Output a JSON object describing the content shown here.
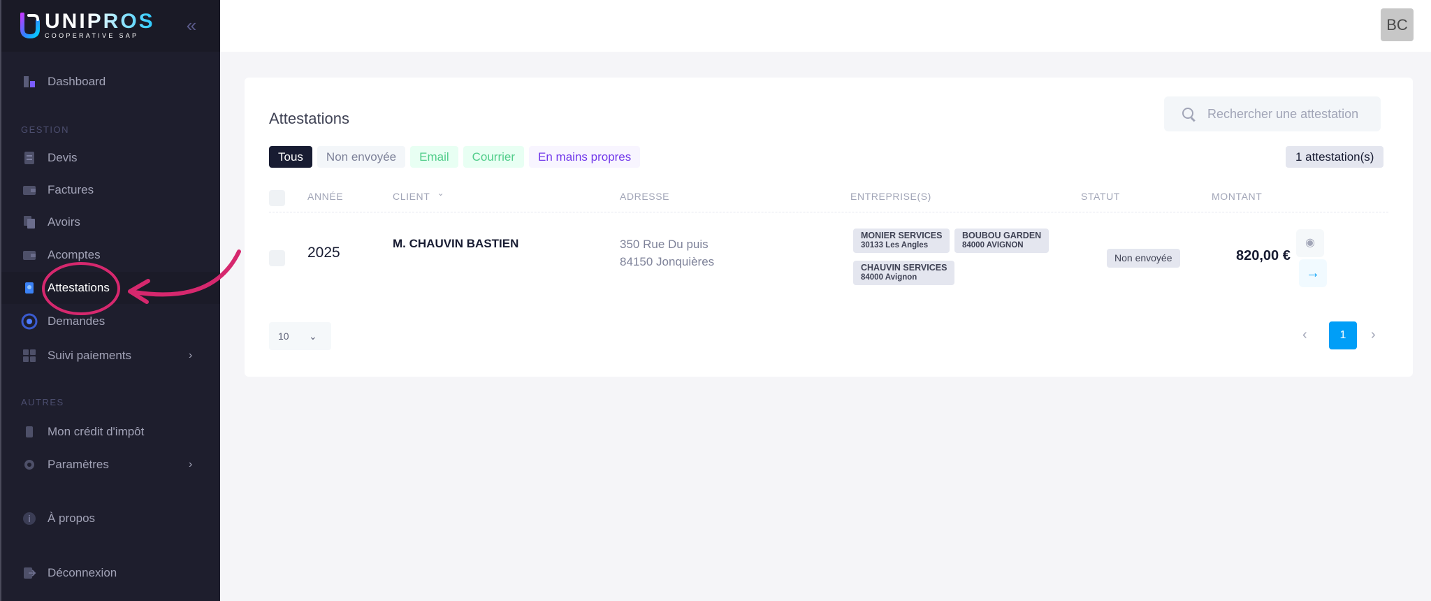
{
  "app": {
    "logo_title": "UNIPROS",
    "logo_subtitle": "COOPERATIVE SAP",
    "collapse_icon": "«",
    "avatar_initials": "BC"
  },
  "sidebar": {
    "dashboard": "Dashboard",
    "section_gestion": "GESTION",
    "devis": "Devis",
    "factures": "Factures",
    "avoirs": "Avoirs",
    "acomptes": "Acomptes",
    "attestations": "Attestations",
    "demandes": "Demandes",
    "suivi_paiements": "Suivi paiements",
    "section_autres": "AUTRES",
    "credit_impot": "Mon crédit d'impôt",
    "parametres": "Paramètres",
    "a_propos": "À propos",
    "deconnexion": "Déconnexion"
  },
  "page": {
    "title": "Attestations",
    "search_placeholder": "Rechercher une attestation",
    "count_badge": "1 attestation(s)",
    "filters": {
      "tous": "Tous",
      "non_envoyee": "Non envoyée",
      "email": "Email",
      "courrier": "Courrier",
      "mains_propres": "En mains propres"
    }
  },
  "table": {
    "headers": {
      "annee": "ANNÉE",
      "client": "CLIENT",
      "adresse": "ADRESSE",
      "entreprises": "ENTREPRISE(S)",
      "statut": "STATUT",
      "montant": "MONTANT"
    },
    "row": {
      "annee": "2025",
      "client": "M. CHAUVIN BASTIEN",
      "adresse_l1": "350 Rue Du puis",
      "adresse_l2": "84150 Jonquières",
      "entreprises": [
        {
          "name": "MONIER SERVICES",
          "city": "30133 Les Angles"
        },
        {
          "name": "BOUBOU GARDEN",
          "city": "84000 AVIGNON"
        },
        {
          "name": "CHAUVIN SERVICES",
          "city": "84000 Avignon"
        }
      ],
      "statut": "Non envoyée",
      "montant": "820,00 €"
    }
  },
  "pagination": {
    "page_size": "10",
    "current_page": "1"
  },
  "colors": {
    "sidebar_bg": "#1e1e2d",
    "accent_blue": "#009ef7",
    "annotation_pink": "#d6286e"
  }
}
